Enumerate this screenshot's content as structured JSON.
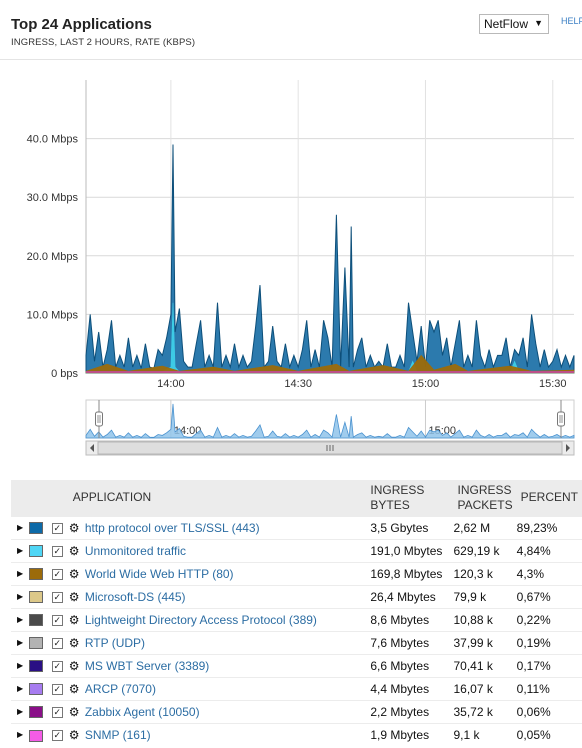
{
  "header": {
    "title": "Top 24 Applications",
    "subtitle": "INGRESS, LAST 2 HOURS, RATE (KBPS)",
    "select_value": "NetFlow",
    "help_label": "HELP"
  },
  "chart_data": {
    "type": "area",
    "xlabel": "",
    "ylabel": "",
    "y_ticks": [
      {
        "value": 0,
        "label": "0 bps"
      },
      {
        "value": 10,
        "label": "10.0 Mbps"
      },
      {
        "value": 20,
        "label": "20.0 Mbps"
      },
      {
        "value": 30,
        "label": "30.0 Mbps"
      },
      {
        "value": 40,
        "label": "40.0 Mbps"
      }
    ],
    "ylim": [
      0,
      50
    ],
    "xlim": [
      "13:40",
      "15:35"
    ],
    "x_ticks": [
      {
        "value": "14:00",
        "label": "14:00"
      },
      {
        "value": "14:30",
        "label": "14:30"
      },
      {
        "value": "15:00",
        "label": "15:00"
      },
      {
        "value": "15:30",
        "label": "15:30"
      }
    ],
    "grid": true,
    "series": [
      {
        "name": "http protocol over TLS/SSL (443)",
        "color": "#1a6fa6",
        "points": [
          [
            "13:40",
            3
          ],
          [
            "13:41",
            10
          ],
          [
            "13:42",
            2
          ],
          [
            "13:43",
            7
          ],
          [
            "13:44",
            1
          ],
          [
            "13:45",
            4
          ],
          [
            "13:46",
            9
          ],
          [
            "13:47",
            1
          ],
          [
            "13:48",
            3
          ],
          [
            "13:49",
            1
          ],
          [
            "13:50",
            6
          ],
          [
            "13:51",
            1
          ],
          [
            "13:52",
            3
          ],
          [
            "13:53",
            0.8
          ],
          [
            "13:54",
            5
          ],
          [
            "13:55",
            1
          ],
          [
            "13:56",
            0.8
          ],
          [
            "13:57",
            4
          ],
          [
            "13:58",
            3
          ],
          [
            "13:59",
            6
          ],
          [
            "14:00",
            10
          ],
          [
            "14:00:30",
            39
          ],
          [
            "14:01",
            7
          ],
          [
            "14:02",
            11
          ],
          [
            "14:03",
            2
          ],
          [
            "14:04",
            1
          ],
          [
            "14:05",
            1
          ],
          [
            "14:06",
            5
          ],
          [
            "14:07",
            9
          ],
          [
            "14:08",
            1
          ],
          [
            "14:09",
            3
          ],
          [
            "14:10",
            1
          ],
          [
            "14:11",
            12
          ],
          [
            "14:12",
            1
          ],
          [
            "14:13",
            3
          ],
          [
            "14:14",
            1
          ],
          [
            "14:15",
            5
          ],
          [
            "14:16",
            1
          ],
          [
            "14:17",
            3
          ],
          [
            "14:18",
            1
          ],
          [
            "14:19",
            2
          ],
          [
            "14:20",
            8
          ],
          [
            "14:21",
            15
          ],
          [
            "14:22",
            1
          ],
          [
            "14:23",
            2
          ],
          [
            "14:24",
            8
          ],
          [
            "14:25",
            2
          ],
          [
            "14:26",
            1
          ],
          [
            "14:27",
            5
          ],
          [
            "14:28",
            1
          ],
          [
            "14:29",
            3
          ],
          [
            "14:30",
            1
          ],
          [
            "14:31",
            4
          ],
          [
            "14:32",
            9
          ],
          [
            "14:33",
            1
          ],
          [
            "14:34",
            4
          ],
          [
            "14:35",
            1
          ],
          [
            "14:36",
            9
          ],
          [
            "14:37",
            6
          ],
          [
            "14:38",
            1
          ],
          [
            "14:39",
            27
          ],
          [
            "14:40",
            1
          ],
          [
            "14:41",
            18
          ],
          [
            "14:42",
            1
          ],
          [
            "14:42:30",
            25
          ],
          [
            "14:43",
            1
          ],
          [
            "14:44",
            4
          ],
          [
            "14:45",
            6
          ],
          [
            "14:46",
            1
          ],
          [
            "14:47",
            3
          ],
          [
            "14:48",
            1
          ],
          [
            "14:49",
            2
          ],
          [
            "14:50",
            1
          ],
          [
            "14:51",
            5
          ],
          [
            "14:52",
            1
          ],
          [
            "14:53",
            1
          ],
          [
            "14:54",
            3
          ],
          [
            "14:55",
            1
          ],
          [
            "14:56",
            12
          ],
          [
            "14:57",
            7
          ],
          [
            "14:58",
            2
          ],
          [
            "14:59",
            8
          ],
          [
            "15:00",
            1
          ],
          [
            "15:01",
            9
          ],
          [
            "15:02",
            7
          ],
          [
            "15:03",
            9
          ],
          [
            "15:04",
            3
          ],
          [
            "15:05",
            6
          ],
          [
            "15:06",
            1
          ],
          [
            "15:07",
            5
          ],
          [
            "15:08",
            9
          ],
          [
            "15:09",
            1
          ],
          [
            "15:10",
            3
          ],
          [
            "15:11",
            1
          ],
          [
            "15:12",
            9
          ],
          [
            "15:13",
            3
          ],
          [
            "15:14",
            1
          ],
          [
            "15:15",
            4
          ],
          [
            "15:16",
            1
          ],
          [
            "15:17",
            3
          ],
          [
            "15:18",
            3
          ],
          [
            "15:19",
            6
          ],
          [
            "15:20",
            1
          ],
          [
            "15:21",
            4
          ],
          [
            "15:22",
            3
          ],
          [
            "15:23",
            6
          ],
          [
            "15:24",
            1
          ],
          [
            "15:25",
            10
          ],
          [
            "15:26",
            5
          ],
          [
            "15:27",
            1
          ],
          [
            "15:28",
            4
          ],
          [
            "15:29",
            1
          ],
          [
            "15:30",
            2
          ],
          [
            "15:31",
            4
          ],
          [
            "15:32",
            1
          ],
          [
            "15:33",
            3
          ],
          [
            "15:34",
            1
          ],
          [
            "15:35",
            3
          ]
        ]
      },
      {
        "name": "Unmonitored traffic",
        "color": "#3ecfe8",
        "points": [
          [
            "13:40",
            0.2
          ],
          [
            "13:58",
            0.2
          ],
          [
            "14:00",
            1
          ],
          [
            "14:00:30",
            12
          ],
          [
            "14:01",
            1
          ],
          [
            "14:02",
            0.2
          ],
          [
            "14:56",
            0.2
          ],
          [
            "14:57",
            2
          ],
          [
            "14:58",
            0.2
          ],
          [
            "15:20",
            0.2
          ],
          [
            "15:21",
            2
          ],
          [
            "15:22",
            0.2
          ],
          [
            "15:35",
            0.2
          ]
        ]
      },
      {
        "name": "World Wide Web HTTP (80)",
        "color": "#9c6b0a",
        "points": [
          [
            "13:40",
            0.3
          ],
          [
            "13:45",
            1.5
          ],
          [
            "13:50",
            0.3
          ],
          [
            "13:58",
            1.2
          ],
          [
            "14:02",
            0.3
          ],
          [
            "14:10",
            1
          ],
          [
            "14:15",
            0.3
          ],
          [
            "14:24",
            1.3
          ],
          [
            "14:30",
            0.3
          ],
          [
            "14:39",
            1.5
          ],
          [
            "14:42",
            0.3
          ],
          [
            "14:50",
            1.3
          ],
          [
            "14:56",
            0.3
          ],
          [
            "14:59",
            3
          ],
          [
            "15:02",
            0.5
          ],
          [
            "15:07",
            1.5
          ],
          [
            "15:10",
            0.3
          ],
          [
            "15:20",
            1.2
          ],
          [
            "15:25",
            0.3
          ],
          [
            "15:35",
            0.5
          ]
        ]
      }
    ],
    "navigator": {
      "x_ticks": [
        {
          "value": "14:00",
          "label": "14:00"
        },
        {
          "value": "15:00",
          "label": "15:00"
        }
      ]
    }
  },
  "table": {
    "headers": {
      "application": "APPLICATION",
      "bytes": "INGRESS BYTES",
      "packets": "INGRESS PACKETS",
      "percent": "PERCENT"
    },
    "rows": [
      {
        "color": "#0d6aa8",
        "name": "http protocol over TLS/SSL (443)",
        "bytes": "3,5 Gbytes",
        "packets": "2,62 M",
        "percent": "89,23%"
      },
      {
        "color": "#4fd6f5",
        "name": "Unmonitored traffic",
        "bytes": "191,0 Mbytes",
        "packets": "629,19 k",
        "percent": "4,84%"
      },
      {
        "color": "#9c6b0a",
        "name": "World Wide Web HTTP (80)",
        "bytes": "169,8 Mbytes",
        "packets": "120,3 k",
        "percent": "4,3%"
      },
      {
        "color": "#dcc889",
        "name": "Microsoft-DS (445)",
        "bytes": "26,4 Mbytes",
        "packets": "79,9 k",
        "percent": "0,67%"
      },
      {
        "color": "#4a4a4a",
        "name": "Lightweight Directory Access Protocol (389)",
        "bytes": "8,6 Mbytes",
        "packets": "10,88 k",
        "percent": "0,22%"
      },
      {
        "color": "#b3b3b3",
        "name": "RTP (UDP)",
        "bytes": "7,6 Mbytes",
        "packets": "37,99 k",
        "percent": "0,19%"
      },
      {
        "color": "#2a0f84",
        "name": "MS WBT Server (3389)",
        "bytes": "6,6 Mbytes",
        "packets": "70,41 k",
        "percent": "0,17%"
      },
      {
        "color": "#a77cf0",
        "name": "ARCP (7070)",
        "bytes": "4,4 Mbytes",
        "packets": "16,07 k",
        "percent": "0,11%"
      },
      {
        "color": "#8a0f88",
        "name": "Zabbix Agent (10050)",
        "bytes": "2,2 Mbytes",
        "packets": "35,72 k",
        "percent": "0,06%"
      },
      {
        "color": "#f45ce6",
        "name": "SNMP (161)",
        "bytes": "1,9 Mbytes",
        "packets": "9,1 k",
        "percent": "0,05%"
      }
    ]
  }
}
